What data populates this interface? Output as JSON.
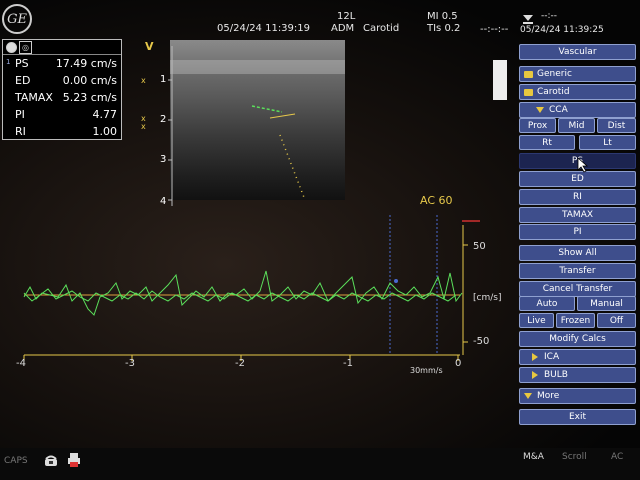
{
  "header": {
    "left_date_time": "05/24/24 11:39:19",
    "probe": "12L",
    "mode": "ADM",
    "preset": "Carotid",
    "mi": "MI 0.5",
    "tis": "TIs 0.2",
    "dashes": "--:--:--",
    "top_dashes": "--:--",
    "right_date_time": "05/24/24 11:39:25",
    "logo": "GE"
  },
  "measurements": [
    {
      "index": "1",
      "label": "PS",
      "value": "17.49 cm/s"
    },
    {
      "index": "",
      "label": "ED",
      "value": "0.00 cm/s"
    },
    {
      "index": "",
      "label": "TAMAX",
      "value": "5.23 cm/s"
    },
    {
      "index": "",
      "label": "PI",
      "value": "4.77"
    },
    {
      "index": "",
      "label": "RI",
      "value": "1.00"
    }
  ],
  "depth_scale": {
    "marker": "V",
    "ticks": [
      "1",
      "2",
      "3",
      "4"
    ]
  },
  "doppler": {
    "angle": "AC 60",
    "velocity_ticks": [
      "50",
      "-50"
    ],
    "unit": "[cm/s]",
    "time_ticks": [
      "-4",
      "-3",
      "-2",
      "-1",
      "0"
    ],
    "sweep": "30mm/s"
  },
  "panel": {
    "vascular": "Vascular",
    "generic": "Generic",
    "carotid": "Carotid",
    "cca": "CCA",
    "prox": "Prox",
    "mid": "Mid",
    "dist": "Dist",
    "rt": "Rt",
    "lt": "Lt",
    "ps": "PS",
    "ed": "ED",
    "ri": "RI",
    "tamax": "TAMAX",
    "pi": "PI",
    "show_all": "Show All",
    "transfer": "Transfer",
    "cancel_transfer": "Cancel Transfer",
    "auto": "Auto",
    "manual": "Manual",
    "live": "Live",
    "frozen": "Frozen",
    "off": "Off",
    "modify_calcs": "Modify Calcs",
    "ica": "ICA",
    "bulb": "BULB",
    "more": "More",
    "exit": "Exit"
  },
  "bottom": {
    "caps": "CAPS",
    "ma": "M&A",
    "scroll": "Scroll",
    "ac": "AC"
  },
  "colors": {
    "panel_button": "#3e4e8c",
    "trace": "#5be05b",
    "scale": "#e6c84a",
    "baseline": "#e0a040"
  }
}
